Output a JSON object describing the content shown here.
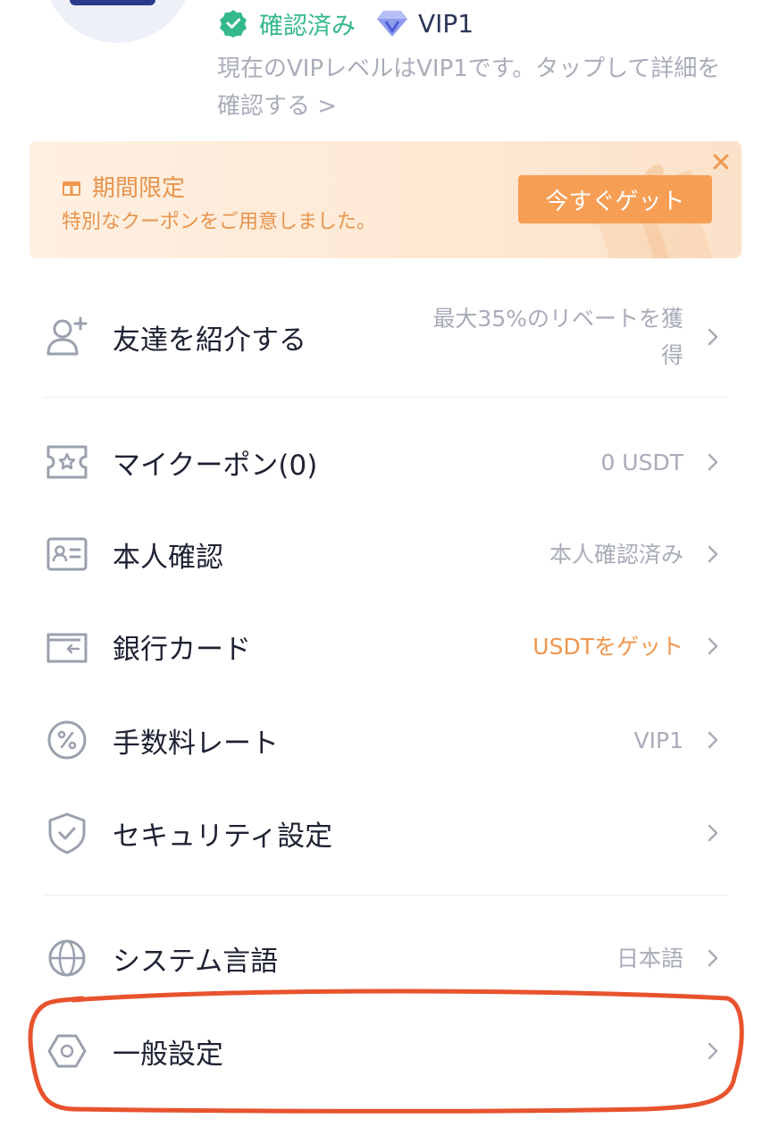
{
  "profile": {
    "verified_text": "確認済み",
    "vip_level": "VIP1",
    "vip_description": "現在のVIPレベルはVIP1です。タップして詳細を確認する >"
  },
  "promo": {
    "title": "期間限定",
    "subtitle": "特別なクーポンをご用意しました。",
    "button_label": "今すぐゲット",
    "close_icon": "close-icon"
  },
  "menu": {
    "invite": {
      "label": "友達を紹介する",
      "value": "最大35%のリベートを獲得",
      "icon": "add-user-icon"
    },
    "coupons": {
      "label": "マイクーポン(0)",
      "value": "0 USDT",
      "icon": "ticket-icon"
    },
    "kyc": {
      "label": "本人確認",
      "value": "本人確認済み",
      "icon": "id-card-icon"
    },
    "bank_card": {
      "label": "銀行カード",
      "value": "USDTをゲット",
      "icon": "wallet-icon"
    },
    "fee_rate": {
      "label": "手数料レート",
      "value": "VIP1",
      "icon": "percent-icon"
    },
    "security": {
      "label": "セキュリティ設定",
      "value": "",
      "icon": "shield-check-icon"
    },
    "language": {
      "label": "システム言語",
      "value": "日本語",
      "icon": "globe-icon"
    },
    "general": {
      "label": "一般設定",
      "value": "",
      "icon": "hexagon-settings-icon"
    }
  },
  "colors": {
    "accent_orange": "#f79e55",
    "verified_green": "#35b98a",
    "annotation_red": "#e8532e"
  }
}
